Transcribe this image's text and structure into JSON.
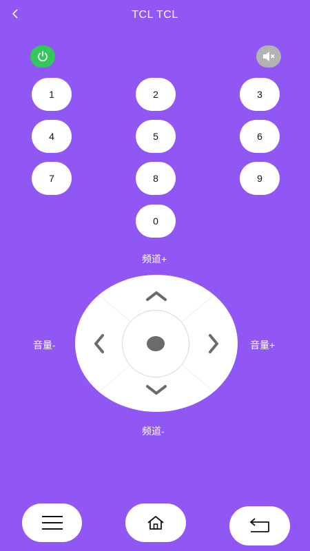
{
  "header": {
    "title": "TCL TCL",
    "back_icon": "chevron-left-icon"
  },
  "top_controls": {
    "power_icon": "power-icon",
    "power_color": "#34c759",
    "mute_icon": "mute-icon",
    "mute_color": "#b3b3b3"
  },
  "number_pad": {
    "keys": [
      "1",
      "2",
      "3",
      "4",
      "5",
      "6",
      "7",
      "8",
      "9",
      "0"
    ]
  },
  "labels": {
    "channel_up": "频道+",
    "channel_down": "频道-",
    "volume_down": "音量-",
    "volume_up": "音量+"
  },
  "bottom_bar": {
    "menu_icon": "menu-icon",
    "home_icon": "home-icon",
    "back_icon": "return-icon"
  },
  "colors": {
    "background": "#9157f5",
    "button": "#ffffff",
    "arrow": "#6b6b6b"
  }
}
